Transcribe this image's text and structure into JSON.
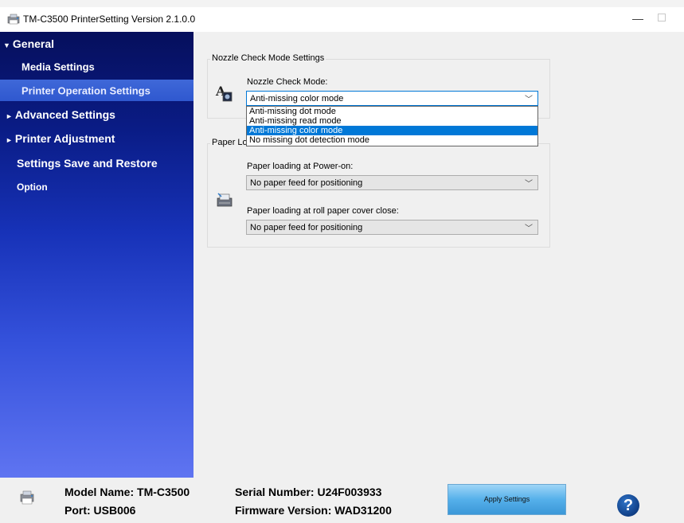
{
  "window": {
    "title": "TM-C3500 PrinterSetting Version 2.1.0.0",
    "minimize_glyph": "—"
  },
  "sidebar": {
    "items": [
      {
        "label": "General",
        "arrow": "▼",
        "level": 0
      },
      {
        "label": "Media Settings",
        "level": 1
      },
      {
        "label": "Printer Operation Settings",
        "level": 1,
        "selected": true
      },
      {
        "label": "Advanced Settings",
        "arrow": "►",
        "level": 0
      },
      {
        "label": "Printer Adjustment",
        "arrow": "►",
        "level": 0
      },
      {
        "label": "Settings Save and Restore",
        "level": 0
      },
      {
        "label": "Option",
        "level": 0
      }
    ]
  },
  "nozzle_group": {
    "title": "Nozzle Check Mode Settings",
    "field_label": "Nozzle Check Mode:",
    "value": "Anti-missing color mode",
    "options": [
      "Anti-missing dot mode",
      "Anti-missing read mode",
      "Anti-missing color mode",
      "No missing dot detection mode"
    ],
    "highlighted_index": 2
  },
  "paper_group": {
    "title_visible": "Paper Loa",
    "power_on_label": "Paper loading at Power-on:",
    "power_on_value": "No paper feed for positioning",
    "cover_close_label": "Paper loading at roll paper cover close:",
    "cover_close_value": "No paper feed for positioning"
  },
  "footer": {
    "model_name": "Model Name: TM-C3500",
    "port": "Port: USB006",
    "serial_number": "Serial Number: U24F003933",
    "firmware_version": "Firmware Version: WAD31200",
    "apply_label": "Apply Settings",
    "help_glyph": "?"
  },
  "icons": {
    "app": "printer-icon",
    "nozzle": "nozzle-check-icon",
    "paper": "paper-loading-icon",
    "footer_printer": "printer-icon",
    "help": "help-icon",
    "chevron": "chevron-down-icon"
  },
  "colors": {
    "sidebar_top": "#060f5c",
    "sidebar_bottom": "#5f74f1",
    "selected_item": "#2f58cf",
    "highlight": "#0078d7",
    "apply_button": "#55b0ea"
  }
}
